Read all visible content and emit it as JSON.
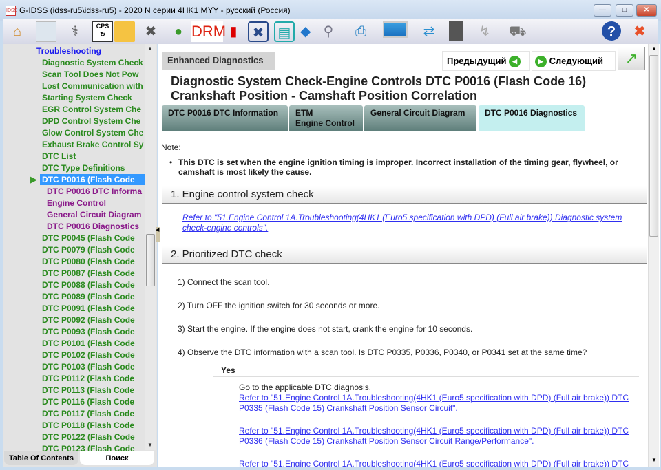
{
  "window": {
    "title": "G-IDSS (idss-ru5\\idss-ru5) - 2020 N серии 4HK1 MYY - русский (Россия)",
    "app_icon": "IDSS"
  },
  "toolbar": {
    "drm_label": "DRM"
  },
  "toc": {
    "root": "Troubleshooting",
    "items": [
      "Diagnostic System Check",
      "Scan Tool Does Not Pow",
      "Lost Communication with",
      "Starting System Check",
      "EGR Control System Che",
      "DPD Control System Che",
      "Glow Control System Che",
      "Exhaust Brake Control Sy",
      "DTC List",
      "DTC Type Definitions"
    ],
    "selected": "DTC P0016 (Flash Code",
    "children": [
      "DTC P0016 DTC Informa",
      "Engine Control",
      "General Circuit Diagram",
      "DTC P0016 Diagnostics"
    ],
    "after": [
      "DTC P0045 (Flash Code",
      "DTC P0079 (Flash Code",
      "DTC P0080 (Flash Code",
      "DTC P0087 (Flash Code",
      "DTC P0088 (Flash Code",
      "DTC P0089 (Flash Code",
      "DTC P0091 (Flash Code",
      "DTC P0092 (Flash Code",
      "DTC P0093 (Flash Code",
      "DTC P0101 (Flash Code",
      "DTC P0102 (Flash Code",
      "DTC P0103 (Flash Code",
      "DTC P0112 (Flash Code",
      "DTC P0113 (Flash Code",
      "DTC P0116 (Flash Code",
      "DTC P0117 (Flash Code",
      "DTC P0118 (Flash Code",
      "DTC P0122 (Flash Code",
      "DTC P0123 (Flash Code"
    ],
    "tabs": [
      "Table Of Contents",
      "Поиск"
    ]
  },
  "content": {
    "enhanced": "Enhanced Diagnostics",
    "prev": "Предыдущий",
    "next": "Следующий",
    "title1": "Diagnostic System Check-Engine Controls DTC P0016 (Flash Code 16)",
    "title2": "Crankshaft Position - Camshaft Position Correlation",
    "tabs": [
      {
        "l1": "DTC P0016 DTC Information",
        "l2": ""
      },
      {
        "l1": "ETM",
        "l2": "Engine Control"
      },
      {
        "l1": "General Circuit Diagram",
        "l2": ""
      },
      {
        "l1": "DTC P0016 Diagnostics",
        "l2": ""
      }
    ],
    "note_label": "Note:",
    "note": "This DTC is set when the engine ignition timing is improper. Incorrect installation of the timing gear, flywheel, or camshaft is most likely the cause.",
    "section1": "1. Engine control system check",
    "link1": "Refer to \"51.Engine Control 1A.Troubleshooting(4HK1 (Euro5 specification with DPD) (Full air brake)) Diagnostic system check-engine controls\".",
    "section2": "2. Prioritized DTC check",
    "steps": [
      "1) Connect the scan tool.",
      "2) Turn OFF the ignition switch for 30 seconds or more.",
      "3) Start the engine. If the engine does not start, crank the engine for 10 seconds.",
      "4) Observe the DTC information with a scan tool. Is DTC P0335, P0336, P0340, or P0341 set at the same time?"
    ],
    "yes": "Yes",
    "yes_text": "Go to the applicable DTC diagnosis.",
    "yes_links": [
      "Refer to \"51.Engine Control 1A.Troubleshooting(4HK1 (Euro5 specification with DPD) (Full air brake)) DTC P0335 (Flash Code 15) Crankshaft Position Sensor Circuit\".",
      "Refer to \"51.Engine Control 1A.Troubleshooting(4HK1 (Euro5 specification with DPD) (Full air brake)) DTC P0336 (Flash Code 15) Crankshaft Position Sensor Circuit Range/Performance\".",
      "Refer to \"51.Engine Control 1A.Troubleshooting(4HK1 (Euro5 specification with DPD) (Full air brake)) DTC"
    ]
  }
}
